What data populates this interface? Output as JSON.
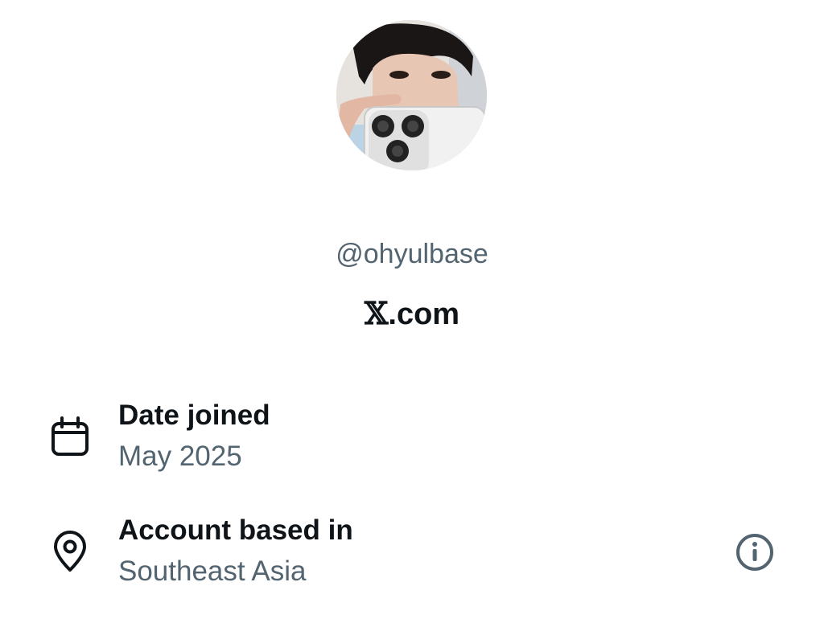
{
  "profile": {
    "avatar_icon": "profile-photo",
    "handle": "@ohyulbase",
    "brand_mark": "𝕏",
    "brand_suffix": ".com"
  },
  "about": {
    "date_joined": {
      "icon": "calendar-icon",
      "title": "Date joined",
      "value": "May 2025"
    },
    "location": {
      "icon": "location-pin-icon",
      "title": "Account based in",
      "value": "Southeast Asia",
      "info_icon": "info-icon"
    }
  },
  "colors": {
    "primary_text": "#0f1419",
    "secondary_text": "#536471",
    "background": "#ffffff"
  }
}
